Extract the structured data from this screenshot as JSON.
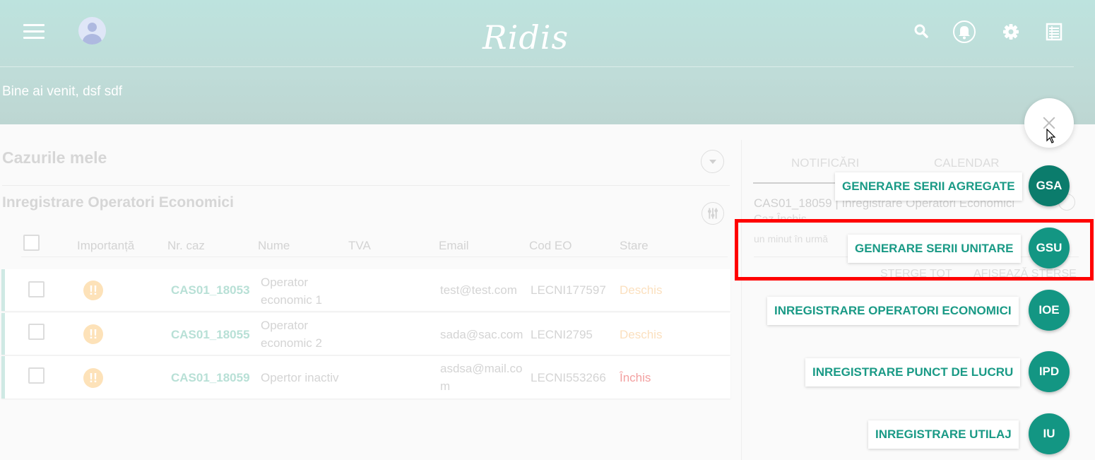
{
  "header": {
    "logo": "Ridis",
    "welcome": "Bine ai venit, dsf sdf",
    "icons": [
      "menu-icon",
      "user-avatar",
      "search-icon",
      "bell-icon",
      "gear-icon",
      "sheet-icon"
    ]
  },
  "cases": {
    "title": "Cazurile mele",
    "section_title": "Inregistrare Operatori Economici",
    "columns": [
      "Importanță",
      "Nr. caz",
      "Nume",
      "TVA",
      "Email",
      "Cod EO",
      "Stare"
    ],
    "rows": [
      {
        "nr": "CAS01_18053",
        "name1": "Operator",
        "name2": "economic 1",
        "tva": "",
        "email1": "test@test.com",
        "email2": "",
        "cod": "LECNI177597",
        "stare": "Deschis"
      },
      {
        "nr": "CAS01_18055",
        "name1": "Operator",
        "name2": "economic 2",
        "tva": "",
        "email1": "sada@sac.com",
        "email2": "",
        "cod": "LECNI2795",
        "stare": "Deschis"
      },
      {
        "nr": "CAS01_18059",
        "name1": "Opertor inactiv",
        "name2": "",
        "tva": "",
        "email1": "asdsa@mail.co",
        "email2": "m",
        "cod": "LECNI553266",
        "stare": "Închis"
      }
    ],
    "status_colors": {
      "Deschis": "#fbe0bf",
      "Închis": "#f3a0a0"
    }
  },
  "right": {
    "tabs": [
      "NOTIFICĂRI",
      "CALENDAR"
    ],
    "notif_title": "CAS01_18059 | Inregistrare Operatori Economici",
    "notif_sub": "Caz Închis",
    "notif_time": "un minut în urmă",
    "link_delete": "ȘTERGE TOT",
    "link_show": "AFIȘEAZĂ ȘTERSE"
  },
  "speed_dial": [
    {
      "label": "GENERARE SERII AGREGATE",
      "abbr": "GSA"
    },
    {
      "label": "GENERARE SERII UNITARE",
      "abbr": "GSU"
    },
    {
      "label": "INREGISTRARE OPERATORI ECONOMICI",
      "abbr": "IOE"
    },
    {
      "label": "INREGISTRARE PUNCT DE LUCRU",
      "abbr": "IPD"
    },
    {
      "label": "INREGISTRARE UTILAJ",
      "abbr": "IU"
    }
  ],
  "colors": {
    "accent": "#139683",
    "highlight": "#ff0000",
    "header": "#bde3de"
  }
}
